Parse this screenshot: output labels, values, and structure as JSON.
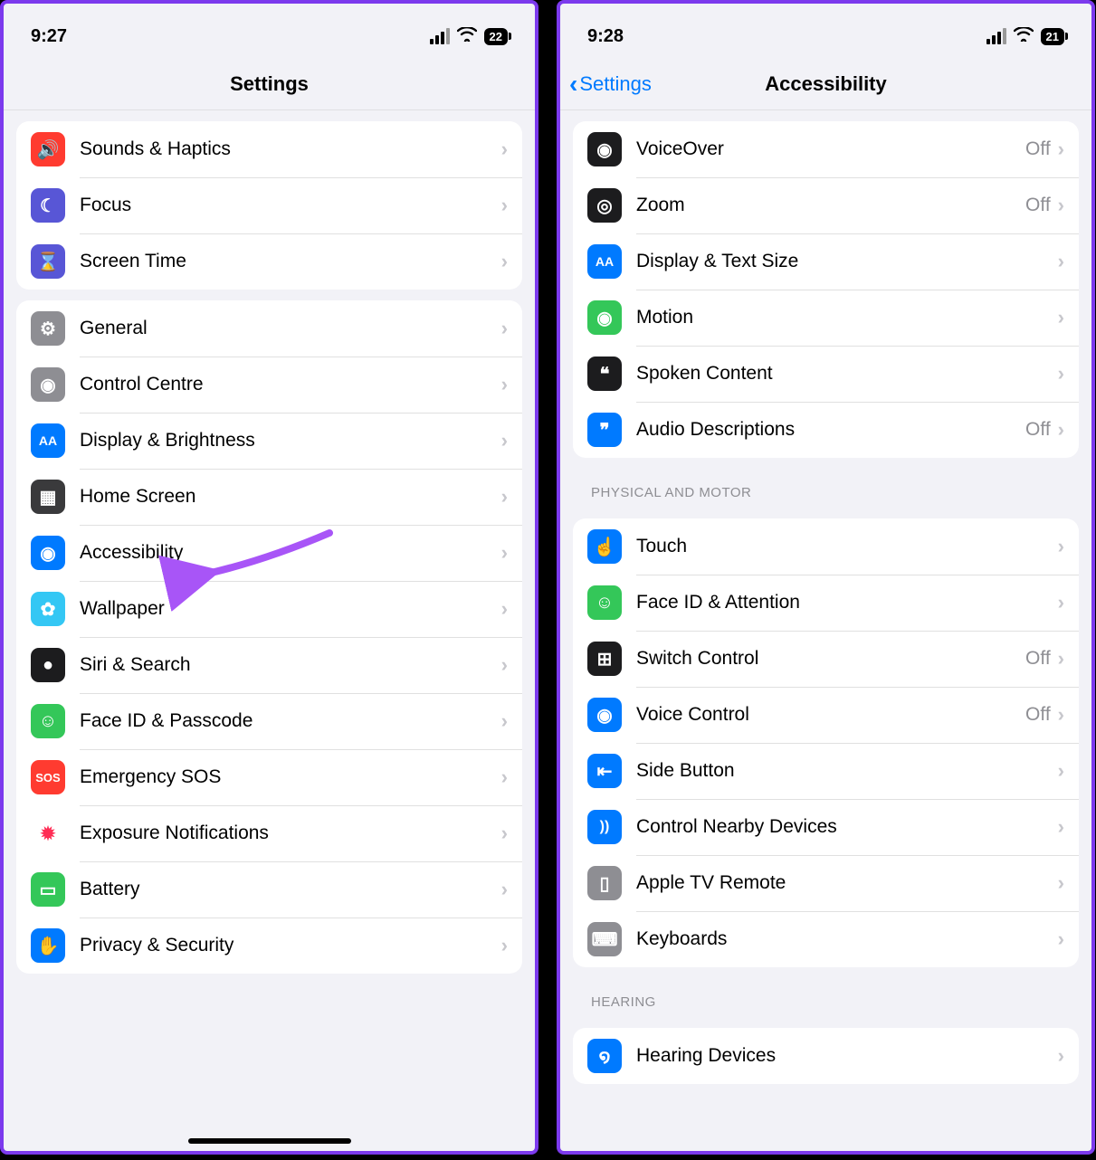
{
  "left": {
    "time": "9:27",
    "battery": "22",
    "title": "Settings",
    "groups": [
      {
        "rows": [
          {
            "icon_bg": "#ff3b30",
            "icon_glyph": "🔊",
            "label": "Sounds & Haptics"
          },
          {
            "icon_bg": "#5856d6",
            "icon_glyph": "☾",
            "label": "Focus"
          },
          {
            "icon_bg": "#5856d6",
            "icon_glyph": "⌛",
            "label": "Screen Time"
          }
        ]
      },
      {
        "rows": [
          {
            "icon_bg": "#8e8e93",
            "icon_glyph": "⚙",
            "label": "General"
          },
          {
            "icon_bg": "#8e8e93",
            "icon_glyph": "◉",
            "label": "Control Centre"
          },
          {
            "icon_bg": "#007aff",
            "icon_glyph": "AA",
            "icon_fs": "14px",
            "label": "Display & Brightness"
          },
          {
            "icon_bg": "#3a3a3c",
            "icon_glyph": "▦",
            "label": "Home Screen"
          },
          {
            "icon_bg": "#007aff",
            "icon_glyph": "◉",
            "label": "Accessibility"
          },
          {
            "icon_bg": "#34c7f4",
            "icon_glyph": "✿",
            "label": "Wallpaper"
          },
          {
            "icon_bg": "#1c1c1e",
            "icon_glyph": "●",
            "label": "Siri & Search"
          },
          {
            "icon_bg": "#34c759",
            "icon_glyph": "☺",
            "label": "Face ID & Passcode"
          },
          {
            "icon_bg": "#ff3b30",
            "icon_glyph": "SOS",
            "icon_fs": "13px",
            "label": "Emergency SOS"
          },
          {
            "icon_bg": "#ffffff",
            "icon_fg": "#ff2d55",
            "icon_glyph": "✹",
            "label": "Exposure Notifications"
          },
          {
            "icon_bg": "#34c759",
            "icon_glyph": "▭",
            "label": "Battery"
          },
          {
            "icon_bg": "#007aff",
            "icon_glyph": "✋",
            "label": "Privacy & Security"
          }
        ]
      }
    ]
  },
  "right": {
    "time": "9:28",
    "battery": "21",
    "back_label": "Settings",
    "title": "Accessibility",
    "groups": [
      {
        "header": null,
        "rows": [
          {
            "icon_bg": "#1c1c1e",
            "icon_glyph": "◉",
            "label": "VoiceOver",
            "value": "Off"
          },
          {
            "icon_bg": "#1c1c1e",
            "icon_glyph": "◎",
            "label": "Zoom",
            "value": "Off"
          },
          {
            "icon_bg": "#007aff",
            "icon_glyph": "AA",
            "icon_fs": "14px",
            "label": "Display & Text Size"
          },
          {
            "icon_bg": "#34c759",
            "icon_glyph": "◉",
            "label": "Motion"
          },
          {
            "icon_bg": "#1c1c1e",
            "icon_glyph": "❝",
            "label": "Spoken Content"
          },
          {
            "icon_bg": "#007aff",
            "icon_glyph": "❞",
            "label": "Audio Descriptions",
            "value": "Off"
          }
        ]
      },
      {
        "header": "PHYSICAL AND MOTOR",
        "rows": [
          {
            "icon_bg": "#007aff",
            "icon_glyph": "☝",
            "label": "Touch"
          },
          {
            "icon_bg": "#34c759",
            "icon_glyph": "☺",
            "label": "Face ID & Attention"
          },
          {
            "icon_bg": "#1c1c1e",
            "icon_glyph": "⊞",
            "label": "Switch Control",
            "value": "Off"
          },
          {
            "icon_bg": "#007aff",
            "icon_glyph": "◉",
            "label": "Voice Control",
            "value": "Off"
          },
          {
            "icon_bg": "#007aff",
            "icon_glyph": "⇤",
            "label": "Side Button"
          },
          {
            "icon_bg": "#007aff",
            "icon_glyph": "))",
            "icon_fs": "16px",
            "label": "Control Nearby Devices"
          },
          {
            "icon_bg": "#8e8e93",
            "icon_glyph": "▯",
            "label": "Apple TV Remote"
          },
          {
            "icon_bg": "#8e8e93",
            "icon_glyph": "⌨",
            "label": "Keyboards"
          }
        ]
      },
      {
        "header": "HEARING",
        "rows": [
          {
            "icon_bg": "#007aff",
            "icon_glyph": "໑",
            "label": "Hearing Devices"
          }
        ]
      }
    ]
  },
  "arrow_color": "#a855f7"
}
